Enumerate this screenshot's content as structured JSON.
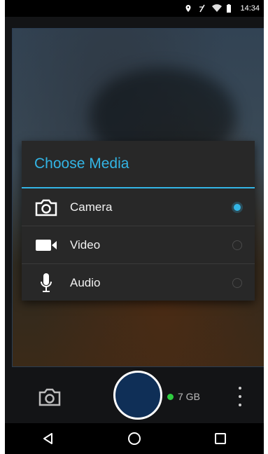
{
  "status_bar": {
    "time": "14:34"
  },
  "dialog": {
    "title": "Choose Media",
    "options": [
      {
        "label": "Camera",
        "icon": "camera-icon",
        "selected": true
      },
      {
        "label": "Video",
        "icon": "video-icon",
        "selected": false
      },
      {
        "label": "Audio",
        "icon": "microphone-icon",
        "selected": false
      }
    ]
  },
  "controls": {
    "storage": "7 GB"
  },
  "colors": {
    "accent": "#33b5e5",
    "shutter": "#0f2f57",
    "storage_dot": "#2ecc40"
  }
}
